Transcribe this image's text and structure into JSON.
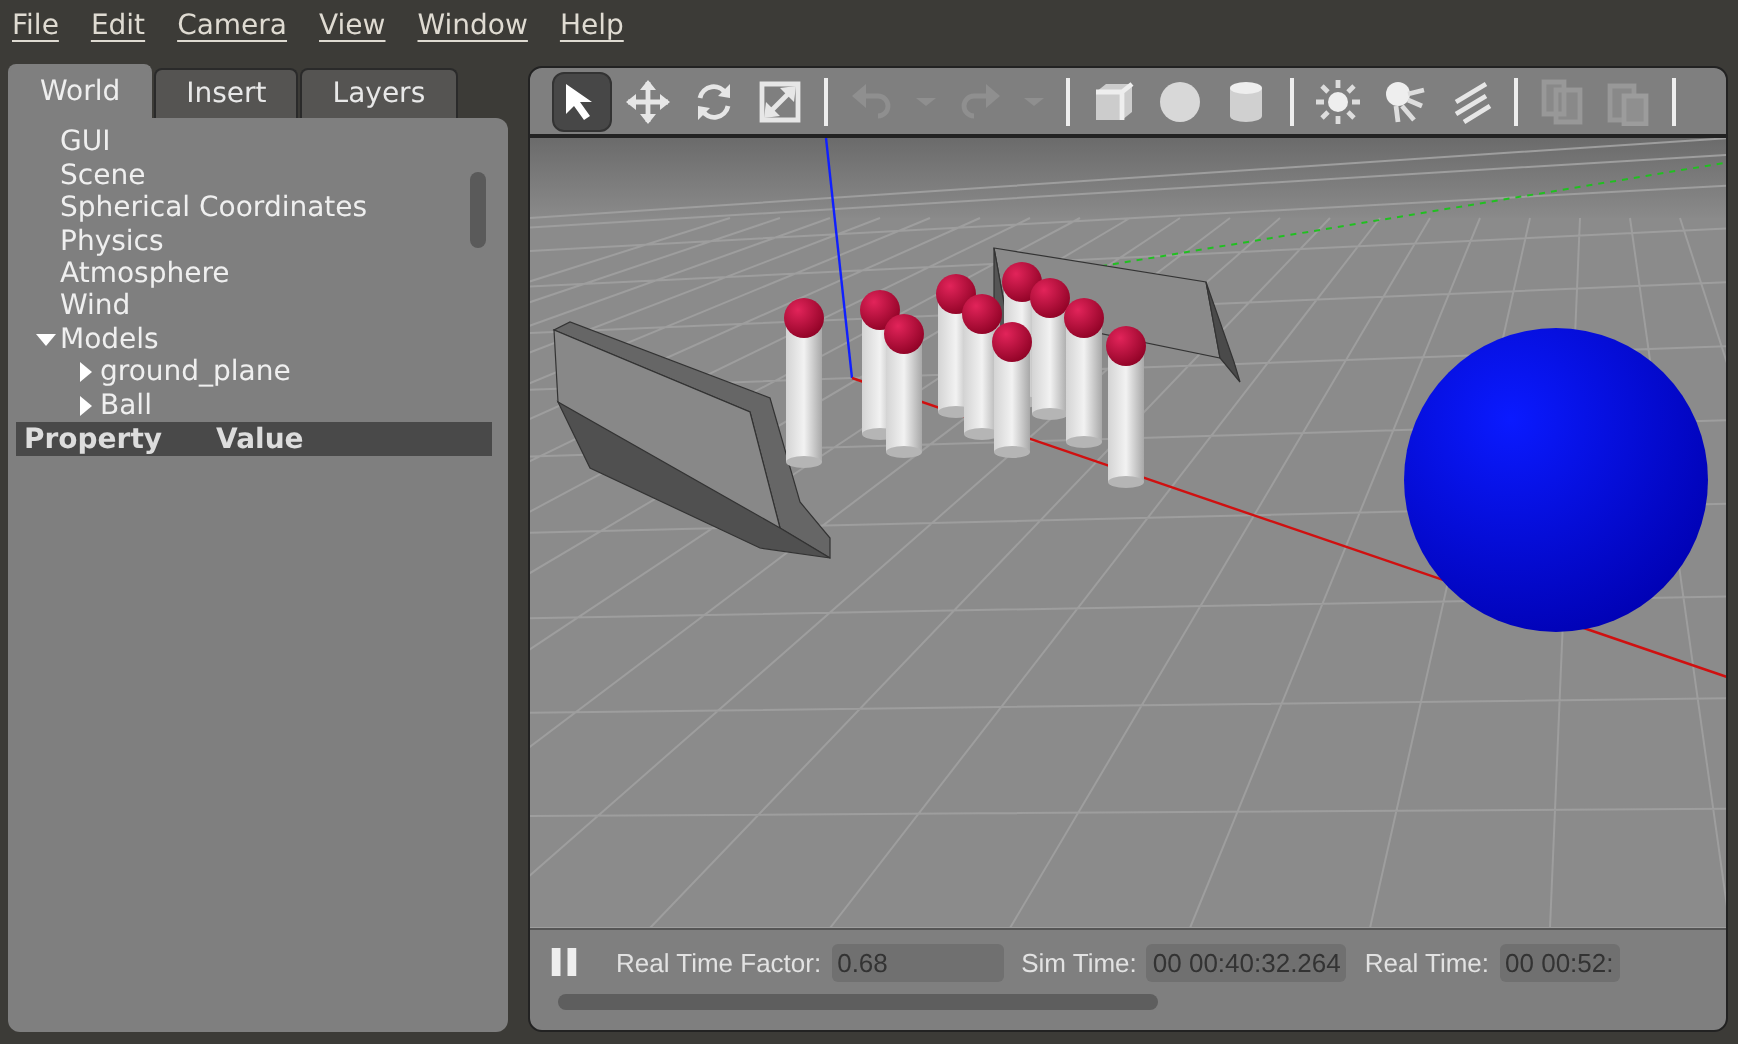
{
  "menu": [
    {
      "label": "File"
    },
    {
      "label": "Edit"
    },
    {
      "label": "Camera"
    },
    {
      "label": "View"
    },
    {
      "label": "Window"
    },
    {
      "label": "Help"
    }
  ],
  "tabs": [
    {
      "label": "World",
      "selected": true
    },
    {
      "label": "Insert",
      "selected": false
    },
    {
      "label": "Layers",
      "selected": false
    }
  ],
  "tree": [
    {
      "label": "GUI"
    },
    {
      "label": "Scene"
    },
    {
      "label": "Spherical Coordinates"
    },
    {
      "label": "Physics"
    },
    {
      "label": "Atmosphere"
    },
    {
      "label": "Wind"
    },
    {
      "label": "Models",
      "expanded": true,
      "children": [
        {
          "label": "ground_plane",
          "expanded": false
        },
        {
          "label": "Ball",
          "expanded": false
        }
      ]
    }
  ],
  "property_table": {
    "columns": [
      "Property",
      "Value"
    ]
  },
  "toolbar": [
    {
      "kind": "select",
      "selected": true,
      "disabled": false
    },
    {
      "kind": "translate",
      "selected": false,
      "disabled": false
    },
    {
      "kind": "rotate",
      "selected": false,
      "disabled": false
    },
    {
      "kind": "scale",
      "selected": false,
      "disabled": false
    },
    {
      "kind": "sep"
    },
    {
      "kind": "undo",
      "selected": false,
      "disabled": true
    },
    {
      "kind": "dropdown",
      "selected": false,
      "disabled": true
    },
    {
      "kind": "redo",
      "selected": false,
      "disabled": true
    },
    {
      "kind": "dropdown",
      "selected": false,
      "disabled": true
    },
    {
      "kind": "sep"
    },
    {
      "kind": "box",
      "selected": false,
      "disabled": false
    },
    {
      "kind": "sphere",
      "selected": false,
      "disabled": false
    },
    {
      "kind": "cylinder",
      "selected": false,
      "disabled": false
    },
    {
      "kind": "sep"
    },
    {
      "kind": "pointlight",
      "selected": false,
      "disabled": false
    },
    {
      "kind": "spotlight",
      "selected": false,
      "disabled": false
    },
    {
      "kind": "dirlight",
      "selected": false,
      "disabled": false
    },
    {
      "kind": "sep"
    },
    {
      "kind": "copy",
      "selected": false,
      "disabled": true
    },
    {
      "kind": "paste",
      "selected": false,
      "disabled": true
    },
    {
      "kind": "sep"
    }
  ],
  "status_bar": {
    "paused": false,
    "fields": [
      {
        "label": "Real Time Factor:",
        "value": "0.68"
      },
      {
        "label": "Sim Time:",
        "value": "00 00:40:32.264"
      },
      {
        "label": "Real Time:",
        "value": "00 00:52:"
      }
    ]
  }
}
